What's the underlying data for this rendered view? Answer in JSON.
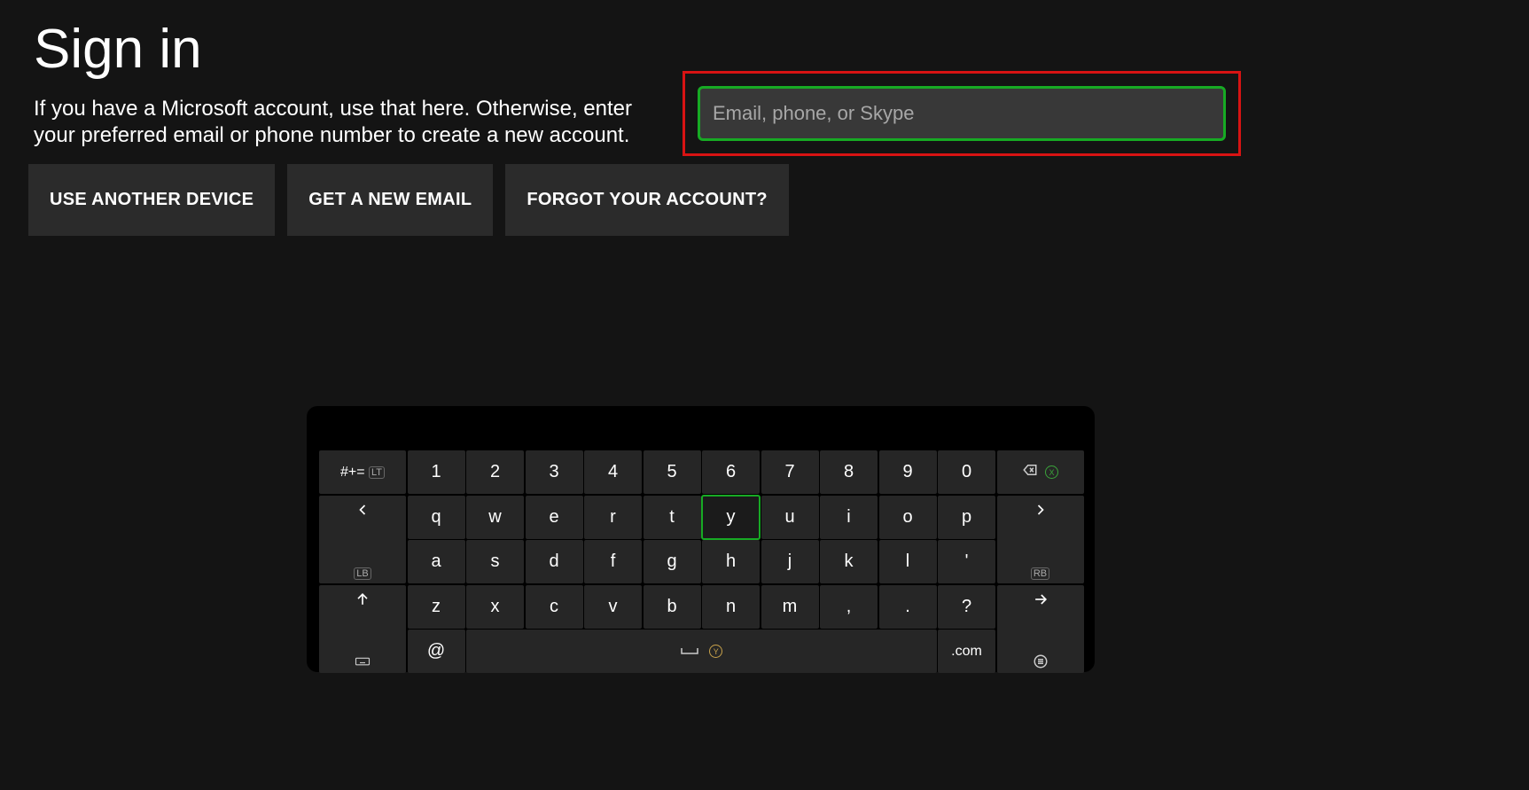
{
  "title": "Sign in",
  "subtitle": "If you have a Microsoft account, use that here. Otherwise, enter your preferred email or phone number to create a new account.",
  "buttons": {
    "another": "USE ANOTHER DEVICE",
    "newemail": "GET A NEW EMAIL",
    "forgot": "FORGOT YOUR ACCOUNT?"
  },
  "input": {
    "value": "",
    "placeholder": "Email, phone, or Skype"
  },
  "keyboard": {
    "symbols_label": "#+=",
    "lt": "LT",
    "lb": "LB",
    "rb": "RB",
    "x": "X",
    "y": "Y",
    "row_num": [
      "1",
      "2",
      "3",
      "4",
      "5",
      "6",
      "7",
      "8",
      "9",
      "0"
    ],
    "row_q": [
      "q",
      "w",
      "e",
      "r",
      "t",
      "y",
      "u",
      "i",
      "o",
      "p"
    ],
    "row_a": [
      "a",
      "s",
      "d",
      "f",
      "g",
      "h",
      "j",
      "k",
      "l",
      "'"
    ],
    "row_z": [
      "z",
      "x",
      "c",
      "v",
      "b",
      "n",
      "m",
      ",",
      ".",
      "?"
    ],
    "at": "@",
    "dotcom": ".com",
    "selected": "y"
  }
}
